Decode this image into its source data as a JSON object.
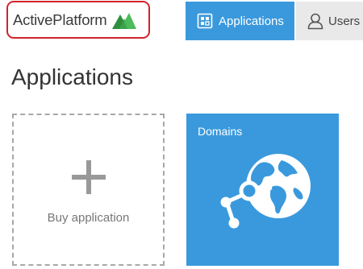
{
  "brand": {
    "name": "ActivePlatform",
    "highlight_color": "#d2232a",
    "mark_color": "#3aa34a"
  },
  "nav": {
    "items": [
      {
        "label": "Applications",
        "icon": "apps-grid-icon",
        "active": true
      },
      {
        "label": "Users",
        "icon": "user-icon",
        "active": false
      }
    ],
    "active_color": "#3a99dd"
  },
  "main": {
    "title": "Applications",
    "tiles": {
      "buy": {
        "label": "Buy application",
        "icon": "plus-icon"
      },
      "apps": [
        {
          "name": "Domains",
          "icon": "globe-network-icon",
          "color": "#3a99dd"
        }
      ]
    }
  }
}
